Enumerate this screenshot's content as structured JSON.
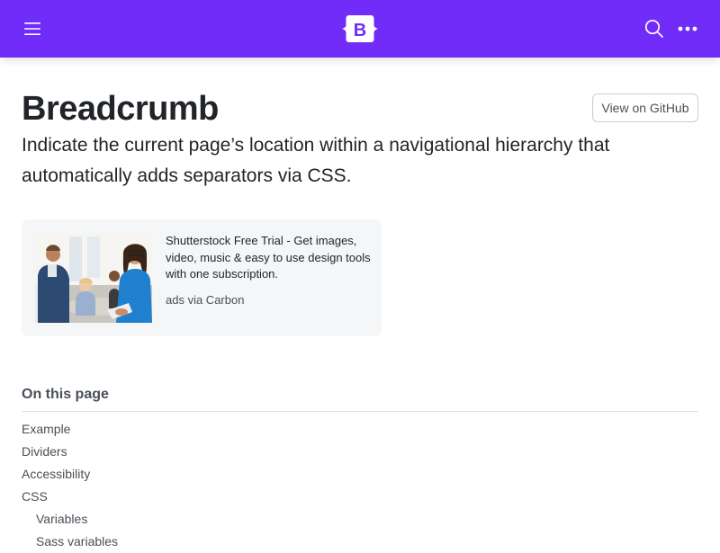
{
  "header": {
    "menu_icon": "hamburger-menu-icon",
    "brand_icon": "bootstrap-logo-icon",
    "brand_text": "B",
    "search_icon": "search-icon",
    "more_icon": "more-horizontal-icon",
    "background_color": "#712cf9"
  },
  "page": {
    "title": "Breadcrumb",
    "github_button": "View on GitHub",
    "lead": "Indicate the current page’s location within a navigational hierarchy that automatically adds separators via CSS."
  },
  "ad": {
    "image_icon": "ad-photo-office-people",
    "text": "Shutterstock Free Trial - Get images, video, music & easy to use design tools with one subscription.",
    "via": "ads via Carbon"
  },
  "toc": {
    "title": "On this page",
    "items": [
      {
        "label": "Example"
      },
      {
        "label": "Dividers"
      },
      {
        "label": "Accessibility"
      },
      {
        "label": "CSS"
      },
      {
        "label": "Variables"
      },
      {
        "label": "Sass variables"
      }
    ]
  }
}
